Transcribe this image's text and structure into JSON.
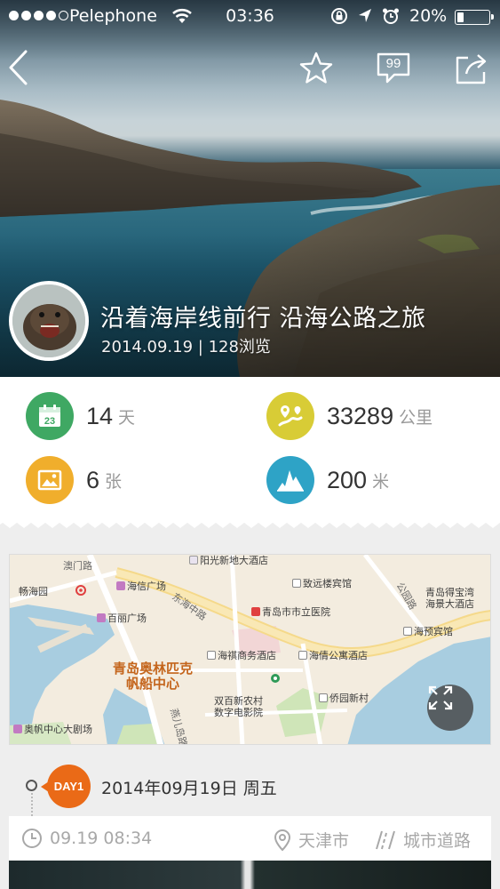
{
  "status_bar": {
    "carrier": "Pelephone",
    "time": "03:36",
    "battery_percent": "20%",
    "battery_level": 0.2,
    "signal_bars": 4
  },
  "nav": {
    "back_icon": "chevron-left-icon",
    "favorite_icon": "star-icon",
    "comments_icon": "comment-bubble-icon",
    "comments_badge": "99",
    "share_icon": "share-icon"
  },
  "trip": {
    "title": "沿着海岸线前行 沿海公路之旅",
    "meta": "2014.09.19 | 128浏览"
  },
  "stats": {
    "days": {
      "value": "14",
      "unit": "天",
      "icon": "calendar-icon",
      "color": "#3fa863",
      "calendar_day": "23"
    },
    "distance": {
      "value": "33289",
      "unit": "公里",
      "icon": "route-pin-icon",
      "color": "#d8cc36"
    },
    "photos": {
      "value": "6",
      "unit": "张",
      "icon": "picture-icon",
      "color": "#f0ae2c"
    },
    "altitude": {
      "value": "200",
      "unit": "米",
      "icon": "elevation-icon",
      "color": "#2ea3c6"
    }
  },
  "map": {
    "labels": {
      "yangguang": "阳光新地大酒店",
      "changhaiyuan": "畅海园",
      "haixin_plaza": "海信广场",
      "zhixuanlou": "致远楼宾馆",
      "debao": "青岛得宝湾\n海景大酒店",
      "bailihui": "百丽广场",
      "hospital": "青岛市市立医院",
      "haiyu": "海预宾馆",
      "major_place": "青岛奥林匹克\n帆船中心",
      "haiqi": "海祺商务酒店",
      "haiqing": "海倩公寓酒店",
      "shuangbai": "双百新农村\n数字电影院",
      "qiaoyuan": "侨园新村",
      "aofan": "奥帆中心大剧场",
      "donghai_road": "东海中路",
      "aomen_road": "澳门路",
      "gongyuan_road": "公园路",
      "yiyang_road": "燕儿岛路"
    }
  },
  "day": {
    "badge": "DAY1",
    "date": "2014年09月19日  周五"
  },
  "entry": {
    "time": "09.19  08:34",
    "city": "天津市",
    "road_type": "城市道路"
  }
}
